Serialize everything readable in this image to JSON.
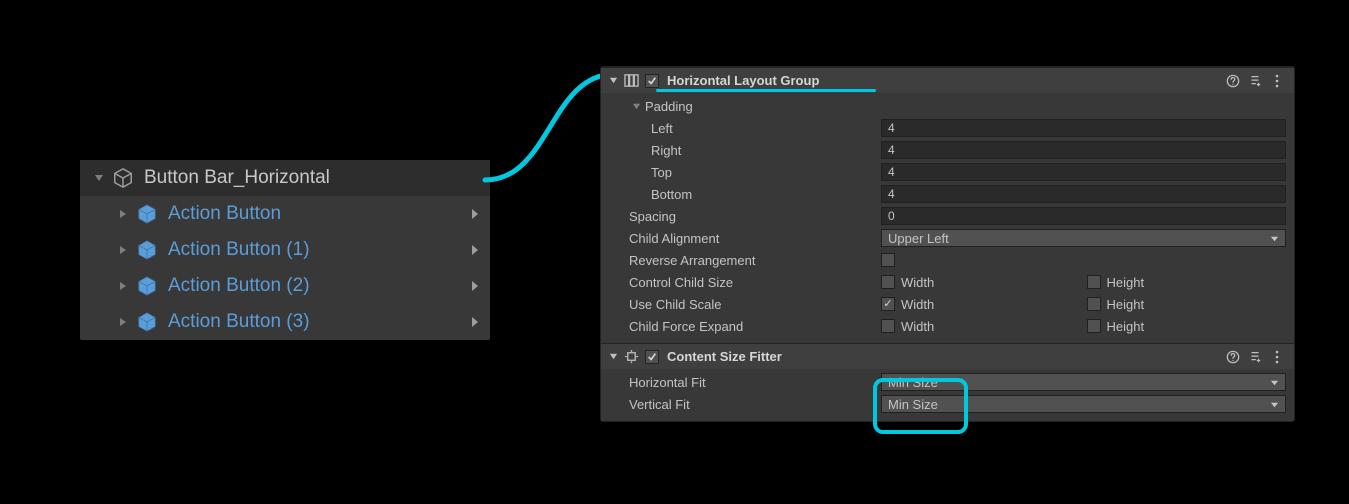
{
  "hierarchy": {
    "root": "Button Bar_Horizontal",
    "children": [
      "Action Button",
      "Action Button (1)",
      "Action Button (2)",
      "Action Button (3)"
    ]
  },
  "layoutGroup": {
    "title": "Horizontal Layout Group",
    "enabled": true,
    "padding": {
      "header": "Padding",
      "left_label": "Left",
      "left": "4",
      "right_label": "Right",
      "right": "4",
      "top_label": "Top",
      "top": "4",
      "bottom_label": "Bottom",
      "bottom": "4"
    },
    "spacing_label": "Spacing",
    "spacing": "0",
    "childAlignment_label": "Child Alignment",
    "childAlignment": "Upper Left",
    "reverse_label": "Reverse Arrangement",
    "reverse": false,
    "controlChild_label": "Control Child Size",
    "controlChild": {
      "width": false,
      "height": false,
      "w_label": "Width",
      "h_label": "Height"
    },
    "useChildScale_label": "Use Child Scale",
    "useChildScale": {
      "width": true,
      "height": false,
      "w_label": "Width",
      "h_label": "Height"
    },
    "childForceExpand_label": "Child Force Expand",
    "childForceExpand": {
      "width": false,
      "height": false,
      "w_label": "Width",
      "h_label": "Height"
    }
  },
  "contentSizeFitter": {
    "title": "Content Size Fitter",
    "enabled": true,
    "horizontal_label": "Horizontal Fit",
    "horizontal": "Min Size",
    "vertical_label": "Vertical Fit",
    "vertical": "Min Size"
  }
}
